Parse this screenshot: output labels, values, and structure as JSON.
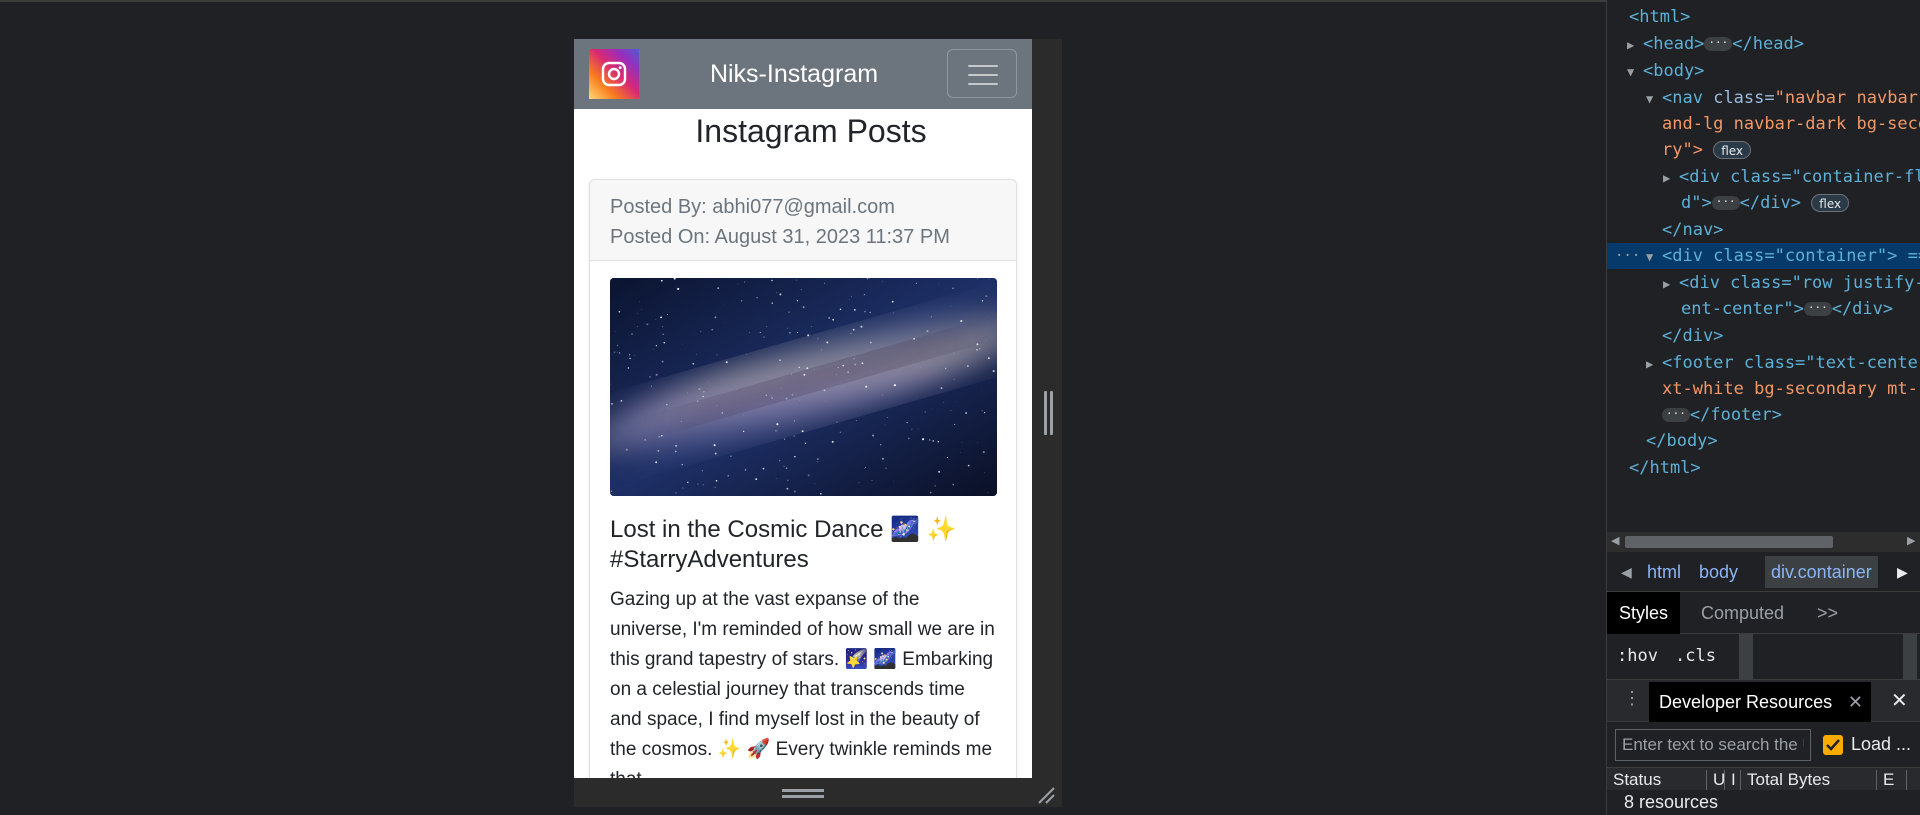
{
  "viewport": {
    "brand": "Niks-Instagram",
    "heading": "Instagram Posts",
    "post": {
      "posted_by": "Posted By: abhi077@gmail.com",
      "posted_on": "Posted On: August 31, 2023 11:37 PM",
      "title": "Lost in the Cosmic Dance 🌌 ✨ #StarryAdventures",
      "body": "Gazing up at the vast expanse of the universe, I'm reminded of how small we are in this grand tapestry of stars. 🌠 🌌 Embarking on a celestial journey that transcends time and space, I find myself lost in the beauty of the cosmos. ✨ 🚀 Every twinkle reminds me that"
    }
  },
  "devtools": {
    "dom": {
      "html_open": "<html>",
      "head": "<head>",
      "head_close": "</head>",
      "body": "<body>",
      "nav_tag": "<nav",
      "nav_class_attr": "class=",
      "nav_class_1": "\"navbar navbar-expand-",
      "nav_class_2": "and-lg navbar-dark bg-seco",
      "nav_class_3": "ry\">",
      "nav_badge": "flex",
      "container_fluid_1": "<div class=\"container-fl",
      "container_fluid_2": "d\">",
      "container_fluid_close": "</div>",
      "container_fluid_badge": "flex",
      "nav_close": "</nav>",
      "container_div": "<div class=\"container\"> ==",
      "row_1": "<div class=\"row justify-c",
      "row_2": "ent-center\">",
      "row_close": "</div>",
      "container_close": "</div>",
      "footer_1": "<footer class=\"text-center",
      "footer_2": "xt-white bg-secondary mt-",
      "footer_close": "</footer>",
      "body_close": "</body>",
      "html_close": "</html>"
    },
    "breadcrumbs": [
      "html",
      "body",
      "div.container"
    ],
    "style_tabs": {
      "styles": "Styles",
      "computed": "Computed",
      "more": ">>"
    },
    "filter": {
      "hov": ":hov",
      "cls": ".cls"
    },
    "drawer_tab": "Developer Resources",
    "search_placeholder": "Enter text to search the URL",
    "load_label": "Load ...",
    "columns": [
      "Status",
      "U",
      "I",
      "Total Bytes",
      "E"
    ],
    "resource_count": "8 resources",
    "colors": {
      "selected": "#063a6b",
      "tag": "#5db0d7",
      "attr_value": "#f29766",
      "checkbox": "#f9ab00"
    }
  }
}
